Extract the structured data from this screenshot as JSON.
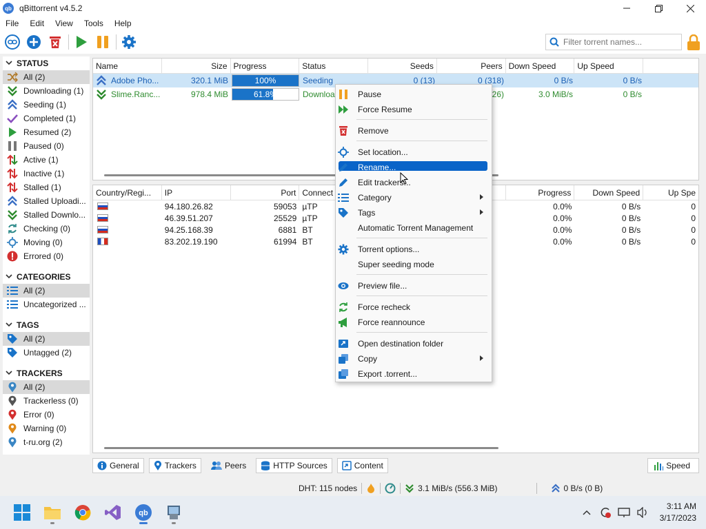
{
  "window": {
    "title": "qBittorrent v4.5.2",
    "app_icon_text": "qb"
  },
  "menu": [
    "File",
    "Edit",
    "View",
    "Tools",
    "Help"
  ],
  "search": {
    "placeholder": "Filter torrent names..."
  },
  "sidebar": {
    "status_header": "STATUS",
    "status_items": [
      {
        "label": "All (2)",
        "icon": "shuffle-icon",
        "color": "#b07a2a"
      },
      {
        "label": "Downloading (1)",
        "icon": "download-icon",
        "color": "#2e8b2e"
      },
      {
        "label": "Seeding (1)",
        "icon": "upload-icon",
        "color": "#3a6fc4"
      },
      {
        "label": "Completed (1)",
        "icon": "check-icon",
        "color": "#8a4fbf"
      },
      {
        "label": "Resumed (2)",
        "icon": "play-icon",
        "color": "#2e9e3e"
      },
      {
        "label": "Paused (0)",
        "icon": "pause-icon",
        "color": "#777777"
      },
      {
        "label": "Active (1)",
        "icon": "active-arrows-icon",
        "color": "#2e8b2e"
      },
      {
        "label": "Inactive (1)",
        "icon": "inactive-arrows-icon",
        "color": "#d33030"
      },
      {
        "label": "Stalled (1)",
        "icon": "stalled-arrows-icon",
        "color": "#d33030"
      },
      {
        "label": "Stalled Uploadi...",
        "icon": "upload-icon",
        "color": "#3a6fc4"
      },
      {
        "label": "Stalled Downlo...",
        "icon": "download-icon",
        "color": "#2e8b2e"
      },
      {
        "label": "Checking (0)",
        "icon": "recheck-icon",
        "color": "#2e8b8b"
      },
      {
        "label": "Moving (0)",
        "icon": "location-icon",
        "color": "#3a86c4"
      },
      {
        "label": "Errored (0)",
        "icon": "error-icon",
        "color": "#d33030"
      }
    ],
    "categories_header": "CATEGORIES",
    "category_items": [
      {
        "label": "All (2)",
        "icon": "list-icon"
      },
      {
        "label": "Uncategorized ...",
        "icon": "list-icon"
      }
    ],
    "tags_header": "TAGS",
    "tag_items": [
      {
        "label": "All (2)",
        "icon": "tag-icon"
      },
      {
        "label": "Untagged (2)",
        "icon": "tag-icon"
      }
    ],
    "trackers_header": "TRACKERS",
    "tracker_items": [
      {
        "label": "All (2)",
        "icon": "pin-icon",
        "color": "#3a86c4"
      },
      {
        "label": "Trackerless (0)",
        "icon": "pin-icon",
        "color": "#555555"
      },
      {
        "label": "Error (0)",
        "icon": "pin-icon",
        "color": "#d33030"
      },
      {
        "label": "Warning (0)",
        "icon": "pin-icon",
        "color": "#e08a1a"
      },
      {
        "label": "t-ru.org (2)",
        "icon": "pin-icon",
        "color": "#3a86c4"
      }
    ]
  },
  "torrents": {
    "columns": [
      "Name",
      "Size",
      "Progress",
      "Status",
      "Seeds",
      "Peers",
      "Down Speed",
      "Up Speed"
    ],
    "rows": [
      {
        "name": "Adobe Pho...",
        "size": "320.1 MiB",
        "progress_text": "100%",
        "progress": 1.0,
        "status": "Seeding",
        "seeds": "0 (13)",
        "peers": "0 (318)",
        "down": "0 B/s",
        "up": "0 B/s",
        "icon": "upload-icon"
      },
      {
        "name": "Slime.Ranc...",
        "size": "978.4 MiB",
        "progress_text": "61.8%",
        "progress": 0.618,
        "status": "Downloa",
        "seeds": "",
        "peers": "26)",
        "down": "3.0 MiB/s",
        "up": "0 B/s",
        "icon": "download-icon"
      }
    ]
  },
  "peers": {
    "columns": [
      "Country/Regi...",
      "IP",
      "Port",
      "Connect",
      "Progress",
      "Down Speed",
      "Up Spe"
    ],
    "rows": [
      {
        "flag": "ru",
        "ip": "94.180.26.82",
        "port": "59053",
        "conn": "µTP",
        "progress": "0.0%",
        "down": "0 B/s",
        "up": "0"
      },
      {
        "flag": "ru",
        "ip": "46.39.51.207",
        "port": "25529",
        "conn": "µTP",
        "progress": "0.0%",
        "down": "0 B/s",
        "up": "0"
      },
      {
        "flag": "ru",
        "ip": "94.25.168.39",
        "port": "6881",
        "conn": "BT",
        "progress": "0.0%",
        "down": "0 B/s",
        "up": "0"
      },
      {
        "flag": "fr",
        "ip": "83.202.19.190",
        "port": "61994",
        "conn": "BT",
        "progress": "0.0%",
        "down": "0 B/s",
        "up": "0"
      }
    ]
  },
  "context_menu": {
    "items": [
      {
        "label": "Pause",
        "icon": "pause-icon"
      },
      {
        "label": "Force Resume",
        "icon": "force-resume-icon"
      },
      {
        "label": "Remove",
        "icon": "trash-icon"
      },
      {
        "label": "Set location...",
        "icon": "location-icon"
      },
      {
        "label": "Rename...",
        "icon": "pencil-icon"
      },
      {
        "label": "Edit trackers...",
        "icon": "pencil-icon"
      },
      {
        "label": "Category",
        "icon": "list-icon"
      },
      {
        "label": "Tags",
        "icon": "tag-icon"
      },
      {
        "label": "Automatic Torrent Management",
        "icon": ""
      },
      {
        "label": "Torrent options...",
        "icon": "gear-icon"
      },
      {
        "label": "Super seeding mode",
        "icon": ""
      },
      {
        "label": "Preview file...",
        "icon": "eye-icon"
      },
      {
        "label": "Force recheck",
        "icon": "recheck-icon"
      },
      {
        "label": "Force reannounce",
        "icon": "megaphone-icon"
      },
      {
        "label": "Open destination folder",
        "icon": "folder-icon"
      },
      {
        "label": "Copy",
        "icon": "copy-icon"
      },
      {
        "label": "Export .torrent...",
        "icon": "export-icon"
      }
    ]
  },
  "tabs": [
    "General",
    "Trackers",
    "Peers",
    "HTTP Sources",
    "Content"
  ],
  "speed_button": "Speed",
  "status_bar": {
    "dht": "DHT: 115 nodes",
    "download": "3.1 MiB/s (556.3 MiB)",
    "upload": "0 B/s (0 B)"
  },
  "clock": {
    "time": "3:11 AM",
    "date": "3/17/2023"
  },
  "colors": {
    "accent": "#0a64c8",
    "selection": "#cce4f7",
    "progress_fill": "#1a73c8"
  }
}
